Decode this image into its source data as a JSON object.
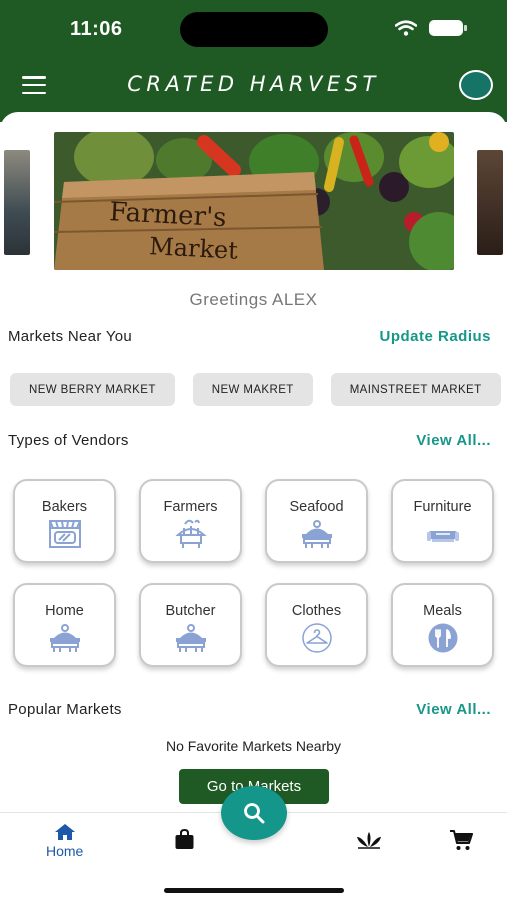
{
  "status": {
    "time": "11:06"
  },
  "header": {
    "title": "CRATED HARVEST"
  },
  "hero": {
    "sign_line1": "Farmer's",
    "sign_line2": "Market"
  },
  "greeting": "Greetings ALEX",
  "markets_near": {
    "title": "Markets Near You",
    "link": "Update Radius",
    "chips": [
      "NEW BERRY MARKET",
      "NEW MAKRET",
      "MAINSTREET MARKET"
    ]
  },
  "vendors": {
    "title": "Types of Vendors",
    "link": "View All...",
    "items": [
      {
        "label": "Bakers",
        "icon": "storefront-icon"
      },
      {
        "label": "Farmers",
        "icon": "market-stall-icon"
      },
      {
        "label": "Seafood",
        "icon": "food-stall-icon"
      },
      {
        "label": "Furniture",
        "icon": "sofa-icon"
      },
      {
        "label": "Home",
        "icon": "food-stall-icon"
      },
      {
        "label": "Butcher",
        "icon": "food-stall-icon"
      },
      {
        "label": "Clothes",
        "icon": "hanger-icon"
      },
      {
        "label": "Meals",
        "icon": "utensils-icon"
      }
    ]
  },
  "popular": {
    "title": "Popular Markets",
    "link": "View All...",
    "empty_message": "No Favorite Markets Nearby",
    "button_label": "Go to Markets"
  },
  "bottom_nav": {
    "home_label": "Home"
  },
  "colors": {
    "primary_green": "#1f5a24",
    "accent_teal": "#17968a",
    "nav_blue": "#1e58a8",
    "icon_blue": "#8aa3d4"
  }
}
